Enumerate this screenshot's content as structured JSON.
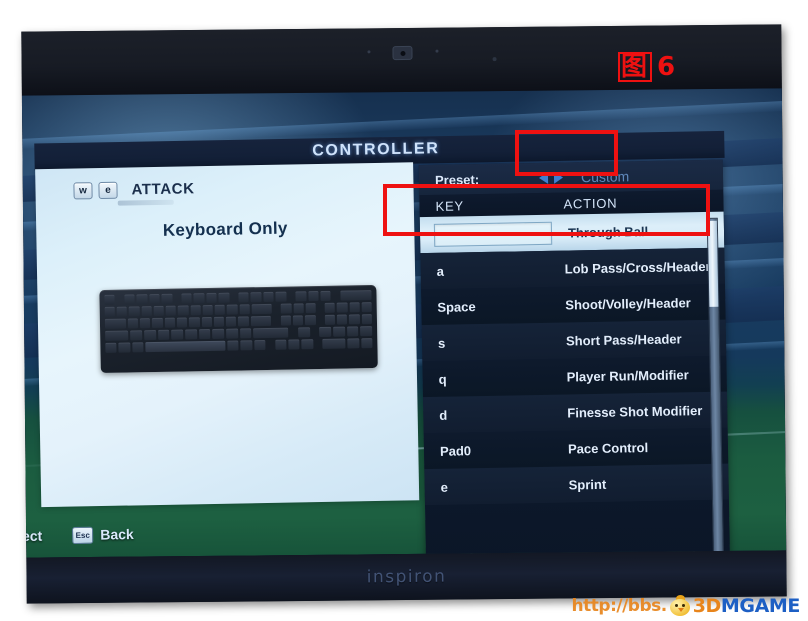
{
  "annotation": {
    "figure_label": "图 6",
    "figure_char": "图",
    "figure_number": "6",
    "box_color": "#ee1111"
  },
  "hardware": {
    "brand_text": "inspiron",
    "webcam_icon": "webcam-icon"
  },
  "screen": {
    "title": "CONTROLLER",
    "left_panel": {
      "tab": {
        "key_left": "w",
        "key_right": "e",
        "label": "ATTACK"
      },
      "mode_label": "Keyboard Only",
      "device_image": "keyboard-illustration"
    },
    "right_panel": {
      "preset": {
        "label": "Preset:",
        "value": "Custom",
        "prev_icon": "triangle-left-icon",
        "next_icon": "triangle-right-icon"
      },
      "columns": {
        "key": "KEY",
        "action": "ACTION"
      },
      "bindings": [
        {
          "key": "",
          "action": "Through Ball",
          "selected": true,
          "input_value": "",
          "input_placeholder": ""
        },
        {
          "key": "a",
          "action": "Lob Pass/Cross/Header",
          "selected": false
        },
        {
          "key": "Space",
          "action": "Shoot/Volley/Header",
          "selected": false
        },
        {
          "key": "s",
          "action": "Short Pass/Header",
          "selected": false
        },
        {
          "key": "q",
          "action": "Player Run/Modifier",
          "selected": false
        },
        {
          "key": "d",
          "action": "Finesse Shot Modifier",
          "selected": false
        },
        {
          "key": "Pad0",
          "action": "Pace Control",
          "selected": false
        },
        {
          "key": "e",
          "action": "Sprint",
          "selected": false
        }
      ],
      "scrollbar": {
        "name": "vertical-scrollbar",
        "thumb_position_percent": 2
      }
    },
    "hints": {
      "select": "lect",
      "back_key": "Esc",
      "back": "Back"
    }
  },
  "watermark": {
    "url": "http://bbs.",
    "brand_prefix": "3D",
    "brand_suffix": "MGAME",
    "mascot_icon": "chick-mascot-icon"
  },
  "colors": {
    "accent_blue": "#3f7fd0",
    "panel_light": "#dcf0fa",
    "panel_dark": "#101d33",
    "annotation_red": "#ee1111",
    "watermark_orange": "#e8851c",
    "watermark_blue": "#1d5fc4"
  }
}
